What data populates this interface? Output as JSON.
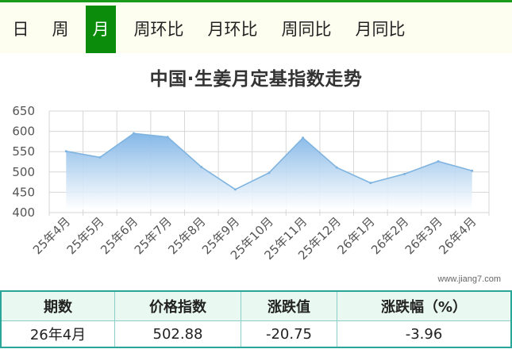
{
  "tabs": [
    {
      "label": "日",
      "active": false
    },
    {
      "label": "周",
      "active": false
    },
    {
      "label": "月",
      "active": true
    },
    {
      "label": "周环比",
      "active": false
    },
    {
      "label": "月环比",
      "active": false
    },
    {
      "label": "周同比",
      "active": false
    },
    {
      "label": "月同比",
      "active": false
    }
  ],
  "watermark": "www.jiang7.com",
  "colors": {
    "accent": "#0b8c0b",
    "line": "#7fb4e0",
    "fill_top": "#7fb4e6",
    "table_border": "#2aa59a",
    "table_header_bg": "#e9f9f1"
  },
  "chart_data": {
    "type": "area",
    "title": "中国·生姜月定基指数走势",
    "categories": [
      "25年4月",
      "25年5月",
      "25年6月",
      "25年7月",
      "25年8月",
      "25年9月",
      "25年10月",
      "25年11月",
      "25年12月",
      "26年1月",
      "26年2月",
      "26年3月",
      "26年4月"
    ],
    "values": [
      551,
      536,
      595,
      586,
      512,
      457,
      498,
      584,
      511,
      473,
      495,
      526,
      503
    ],
    "ylim": [
      400,
      650
    ],
    "yticks": [
      400,
      450,
      500,
      550,
      600,
      650
    ],
    "grid": true
  },
  "table": {
    "headers": [
      "期数",
      "价格指数",
      "涨跌值",
      "涨跌幅（%）"
    ],
    "rows": [
      [
        "26年4月",
        "502.88",
        "-20.75",
        "-3.96"
      ]
    ]
  }
}
